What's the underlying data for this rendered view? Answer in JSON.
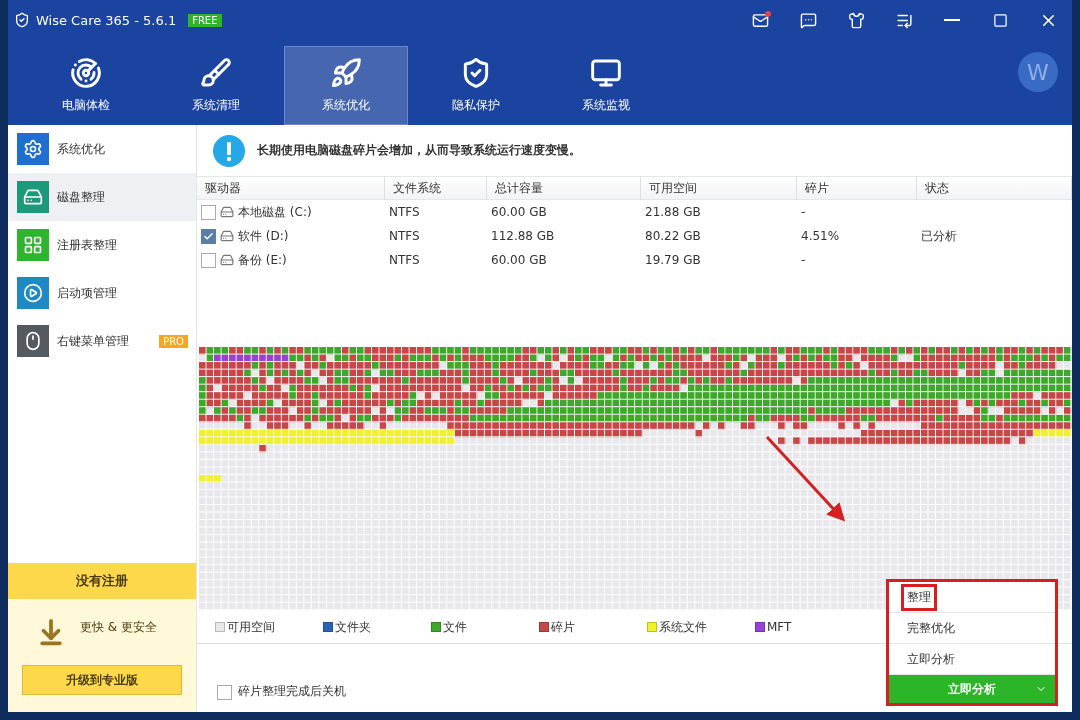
{
  "window": {
    "title": "Wise Care 365 - 5.6.1",
    "badge": "FREE",
    "mail_unread": true
  },
  "nav_tabs": [
    {
      "label": "电脑体检",
      "selected": false
    },
    {
      "label": "系统清理",
      "selected": false
    },
    {
      "label": "系统优化",
      "selected": true
    },
    {
      "label": "隐私保护",
      "selected": false
    },
    {
      "label": "系统监视",
      "selected": false
    }
  ],
  "avatar": {
    "letter": "W"
  },
  "sidebar": {
    "items": [
      {
        "label": "系统优化",
        "selected": false
      },
      {
        "label": "磁盘整理",
        "selected": true
      },
      {
        "label": "注册表整理",
        "selected": false
      },
      {
        "label": "启动项管理",
        "selected": false
      },
      {
        "label": "右键菜单管理",
        "selected": false,
        "badge": "PRO"
      }
    ]
  },
  "register_panel": {
    "title": "没有注册",
    "tagline": "更快 & 更安全",
    "button": "升级到专业版"
  },
  "notice": {
    "text": "长期使用电脑磁盘碎片会增加，从而导致系统运行速度变慢。"
  },
  "table": {
    "columns": [
      "驱动器",
      "文件系统",
      "总计容量",
      "可用空间",
      "碎片",
      "状态"
    ],
    "rows": [
      {
        "checked": false,
        "cells": [
          "本地磁盘 (C:)",
          "NTFS",
          "60.00 GB",
          "21.88 GB",
          "-",
          ""
        ]
      },
      {
        "checked": true,
        "cells": [
          "软件 (D:)",
          "NTFS",
          "112.88 GB",
          "80.22 GB",
          "4.51%",
          "已分析"
        ]
      },
      {
        "checked": false,
        "cells": [
          "备份 (E:)",
          "NTFS",
          "60.00 GB",
          "19.79 GB",
          "-",
          ""
        ]
      }
    ]
  },
  "legend": [
    {
      "label": "可用空间",
      "color": "#e8e8ec"
    },
    {
      "label": "文件夹",
      "color": "#2a64b8"
    },
    {
      "label": "文件",
      "color": "#3ea82a"
    },
    {
      "label": "碎片",
      "color": "#c94646"
    },
    {
      "label": "系统文件",
      "color": "#f2f02a"
    },
    {
      "label": "MFT",
      "color": "#9a3fd8"
    }
  ],
  "shutdown_option": {
    "label": "碎片整理完成后关机",
    "checked": false
  },
  "action_menu": {
    "items": [
      {
        "label": "整理",
        "annotated": true
      },
      {
        "label": "完整优化",
        "annotated": false
      },
      {
        "label": "立即分析",
        "annotated": false
      }
    ],
    "button": "立即分析"
  }
}
